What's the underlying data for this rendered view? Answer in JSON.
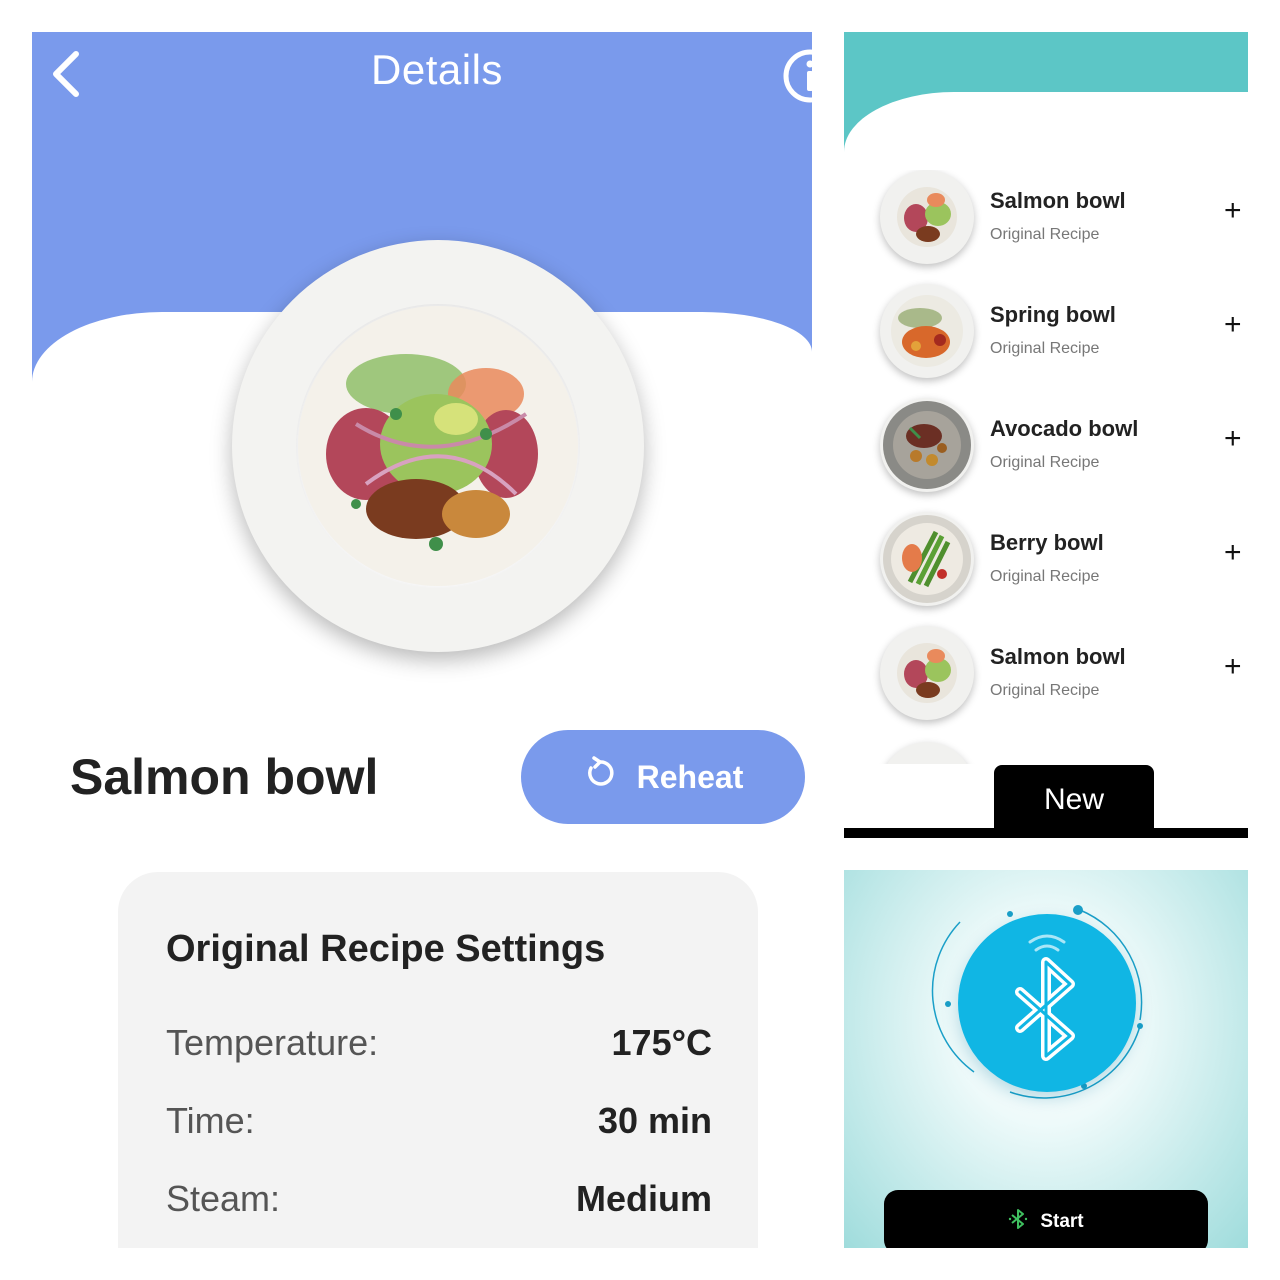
{
  "details": {
    "title": "Details",
    "dish_name": "Salmon bowl",
    "reheat_label": "Reheat",
    "settings": {
      "title": "Original Recipe Settings",
      "rows": [
        {
          "label": "Temperature:",
          "value": "175°C"
        },
        {
          "label": "Time:",
          "value": "30 min"
        },
        {
          "label": "Steam:",
          "value": "Medium"
        }
      ]
    }
  },
  "recipe_list": {
    "items": [
      {
        "title": "Salmon bowl",
        "subtitle": "Original Recipe"
      },
      {
        "title": "Spring bowl",
        "subtitle": "Original Recipe"
      },
      {
        "title": "Avocado bowl",
        "subtitle": "Original Recipe"
      },
      {
        "title": "Berry bowl",
        "subtitle": "Original Recipe"
      },
      {
        "title": "Salmon bowl",
        "subtitle": "Original Recipe"
      }
    ],
    "plus_glyph": "+",
    "new_tab_label": "New"
  },
  "bluetooth": {
    "start_label": "Start",
    "icon": "bluetooth-icon"
  },
  "colors": {
    "details_header": "#7a9aec",
    "list_header": "#5cc6c6",
    "bluetooth_circle": "#10b6e4",
    "start_button": "#000000"
  }
}
